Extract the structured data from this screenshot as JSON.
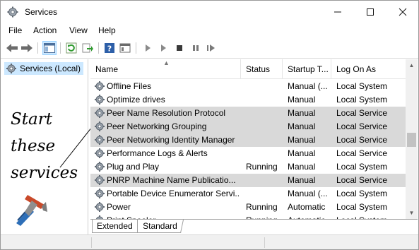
{
  "window": {
    "title": "Services"
  },
  "menu": [
    "File",
    "Action",
    "View",
    "Help"
  ],
  "tree": {
    "item": "Services (Local)"
  },
  "annotation": {
    "lines": [
      "Start",
      "these",
      "services"
    ]
  },
  "columns": {
    "name": "Name",
    "status": "Status",
    "startup": "Startup T...",
    "logon": "Log On As"
  },
  "rows": [
    {
      "name": "Offline Files",
      "status": "",
      "startup": "Manual (...",
      "logon": "Local System",
      "selected": false
    },
    {
      "name": "Optimize drives",
      "status": "",
      "startup": "Manual",
      "logon": "Local System",
      "selected": false
    },
    {
      "name": "Peer Name Resolution Protocol",
      "status": "",
      "startup": "Manual",
      "logon": "Local Service",
      "selected": true
    },
    {
      "name": "Peer Networking Grouping",
      "status": "",
      "startup": "Manual",
      "logon": "Local Service",
      "selected": true
    },
    {
      "name": "Peer Networking Identity Manager",
      "status": "",
      "startup": "Manual",
      "logon": "Local Service",
      "selected": true
    },
    {
      "name": "Performance Logs & Alerts",
      "status": "",
      "startup": "Manual",
      "logon": "Local Service",
      "selected": false
    },
    {
      "name": "Plug and Play",
      "status": "Running",
      "startup": "Manual",
      "logon": "Local System",
      "selected": false
    },
    {
      "name": "PNRP Machine Name Publicatio...",
      "status": "",
      "startup": "Manual",
      "logon": "Local Service",
      "selected": true
    },
    {
      "name": "Portable Device Enumerator Servi...",
      "status": "",
      "startup": "Manual (...",
      "logon": "Local System",
      "selected": false
    },
    {
      "name": "Power",
      "status": "Running",
      "startup": "Automatic",
      "logon": "Local System",
      "selected": false
    },
    {
      "name": "Print Spooler",
      "status": "Running",
      "startup": "Automatic",
      "logon": "Local System",
      "selected": false
    }
  ],
  "tabs": {
    "extended": "Extended",
    "standard": "Standard"
  },
  "colors": {
    "selection": "#d9d9d9",
    "tree_selection": "#cce8ff"
  },
  "icons": [
    "gear-icon",
    "back-arrow-icon",
    "forward-arrow-icon",
    "show-tree-icon",
    "refresh-icon",
    "export-icon",
    "help-icon",
    "properties-icon",
    "play-icon",
    "start-icon",
    "stop-icon",
    "pause-icon",
    "restart-icon"
  ]
}
